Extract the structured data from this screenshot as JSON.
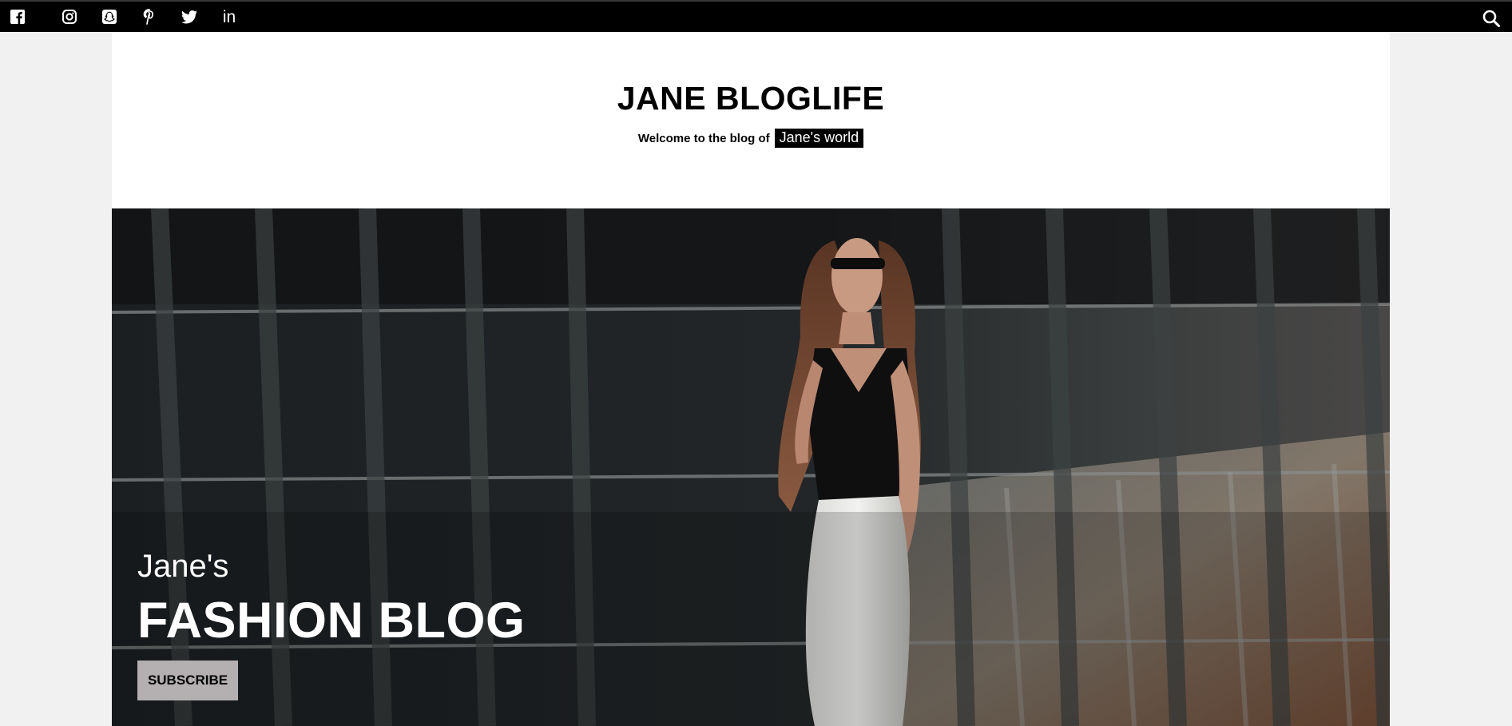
{
  "topbar": {
    "social_icons": [
      "facebook-icon",
      "instagram-icon",
      "snapchat-icon",
      "pinterest-icon",
      "twitter-icon",
      "linkedin-icon"
    ],
    "linkedin_text": "in",
    "search_icon": "search-icon"
  },
  "header": {
    "title": "JANE BLOGLIFE",
    "tagline_prefix": "Welcome to the blog of",
    "tagline_highlight": "Jane's world"
  },
  "hero": {
    "kicker": "Jane's",
    "title": "FASHION BLOG",
    "button_label": "SUBSCRIBE"
  },
  "colors": {
    "topbar_bg": "#000000",
    "page_bg": "#f1f1f1",
    "content_bg": "#ffffff",
    "button_bg": "#b4b0b1",
    "highlight_bg": "#000000"
  }
}
